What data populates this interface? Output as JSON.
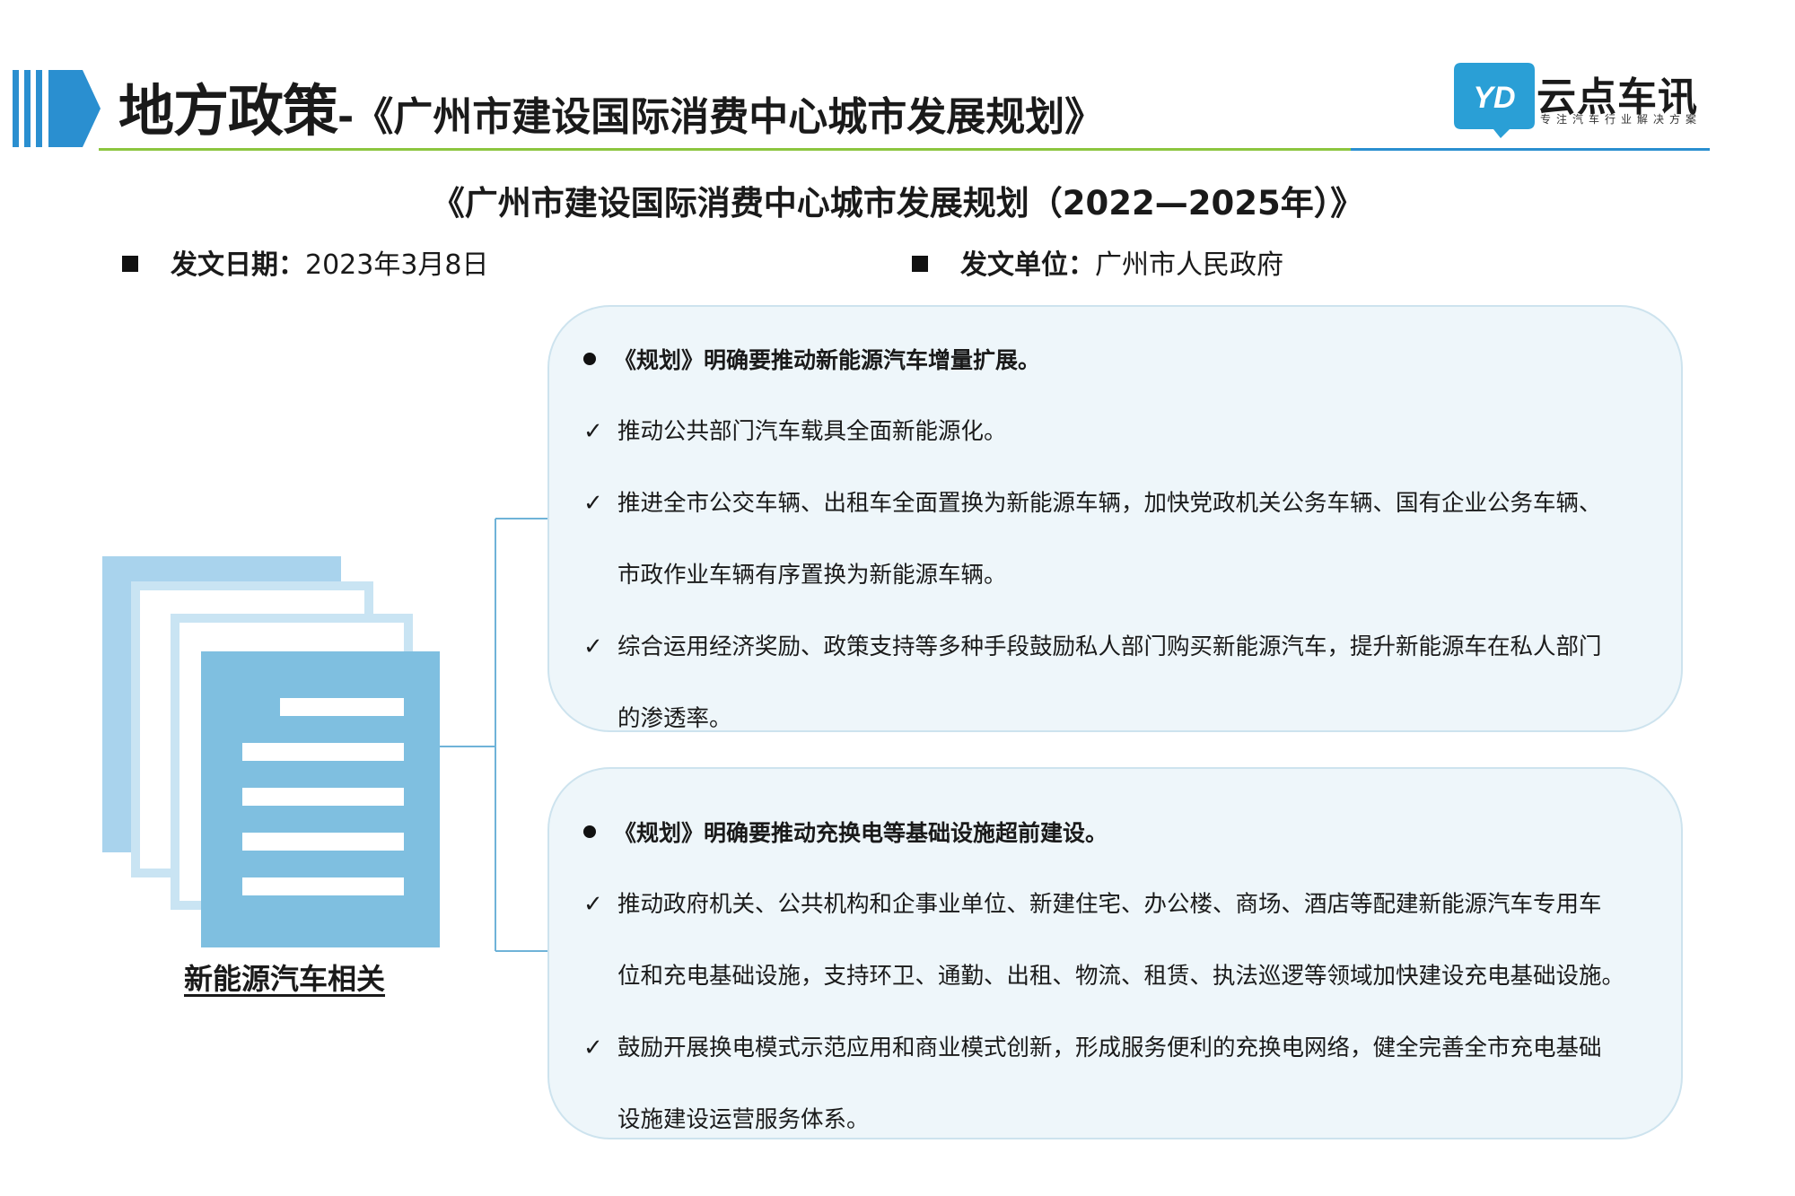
{
  "header": {
    "title_main": "地方政策",
    "title_sub": "-《广州市建设国际消费中心城市发展规划》"
  },
  "brand": {
    "name": "云点车讯",
    "slogan": "专注汽车行业解决方案",
    "logo_letters": "YD",
    "color": "#2a9fd6"
  },
  "document": {
    "title": "《广州市建设国际消费中心城市发展规划（2022—2025年）》",
    "date_label": "发文日期：",
    "date_value": "2023年3月8日",
    "issuer_label": "发文单位：",
    "issuer_value": "广州市人民政府"
  },
  "left": {
    "caption": "新能源汽车相关",
    "icon": "document-stack-icon"
  },
  "panel1": {
    "lead": "《规划》明确要推动新能源汽车增量扩展。",
    "items": [
      {
        "text": "推动公共部门汽车载具全面新能源化。"
      },
      {
        "text": "推进全市公交车辆、出租车全面置换为新能源车辆，加快党政机关公务车辆、国有企业公务车辆、",
        "cont": "市政作业车辆有序置换为新能源车辆。"
      },
      {
        "text": "综合运用经济奖励、政策支持等多种手段鼓励私人部门购买新能源汽车，提升新能源车在私人部门",
        "cont": "的渗透率。"
      }
    ]
  },
  "panel2": {
    "lead": "《规划》明确要推动充换电等基础设施超前建设。",
    "items": [
      {
        "text": "推动政府机关、公共机构和企事业单位、新建住宅、办公楼、商场、酒店等配建新能源汽车专用车",
        "cont": "位和充电基础设施，支持环卫、通勤、出租、物流、租赁、执法巡逻等领域加快建设充电基础设施。"
      },
      {
        "text": "鼓励开展换电模式示范应用和商业模式创新，形成服务便利的充换电网络，健全完善全市充电基础",
        "cont": "设施建设运营服务体系。"
      }
    ]
  },
  "colors": {
    "accent_blue": "#2a8fd0",
    "rule_green": "#8cc63f",
    "panel_bg": "#eef6fa",
    "doc_blue": "#7fbfe0"
  }
}
